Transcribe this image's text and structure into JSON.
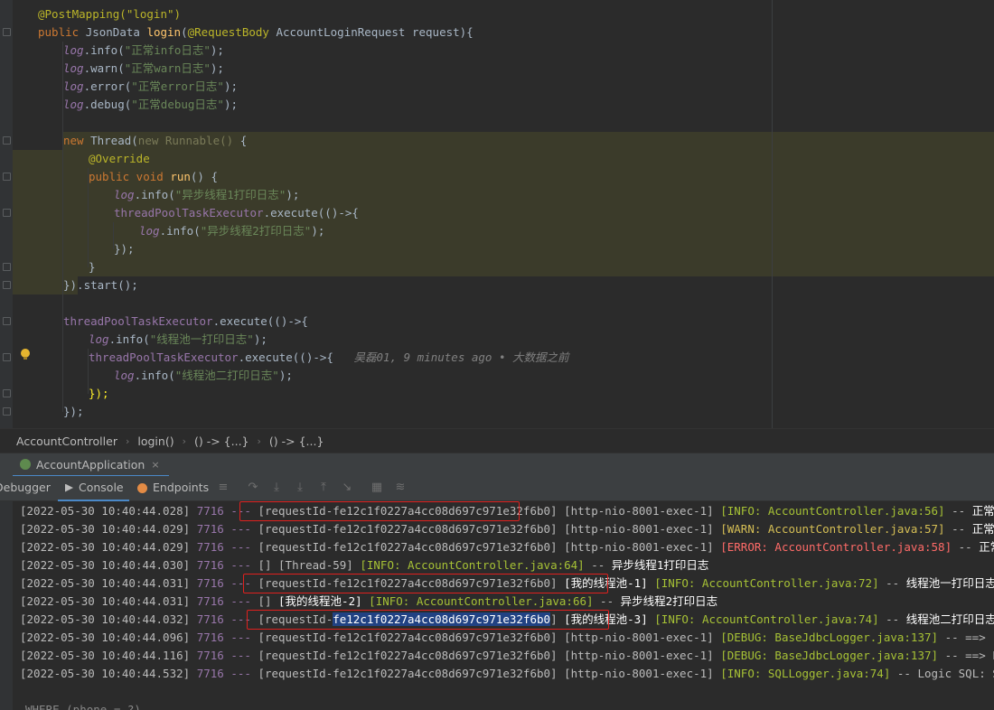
{
  "editor": {
    "annotation": "@PostMapping(\"login\")",
    "signature": {
      "modifier": "public",
      "ret": "JsonData",
      "name": "login",
      "param_ann": "@RequestBody",
      "param_type": "AccountLoginRequest request"
    },
    "log_lines": [
      {
        "method": "info",
        "text": "\"正常info日志\""
      },
      {
        "method": "warn",
        "text": "\"正常warn日志\""
      },
      {
        "method": "error",
        "text": "\"正常error日志\""
      },
      {
        "method": "debug",
        "text": "\"正常debug日志\""
      }
    ],
    "thread_block": {
      "new_kw": "new",
      "thread_cls": "Thread(",
      "runnable": "new Runnable() ",
      "override": "@Override",
      "run_sig_kw": "public void",
      "run_name": "run",
      "log1": "\"异步线程1打印日志\"",
      "executor": "threadPoolTaskExecutor",
      "execute": ".execute(()->{",
      "log2": "\"异步线程2打印日志\"",
      "close1": "});",
      "close2": "}",
      "start": ").start();"
    },
    "pool_block": {
      "log1": "\"线程池一打印日志\"",
      "log2": "\"线程池二打印日志\"",
      "blame": "吴磊01, 9 minutes ago • 大数据之前",
      "close_inner": "});",
      "close_outer": "});"
    },
    "log_ident": "log",
    "info_m": "info"
  },
  "breadcrumb": [
    "AccountController",
    "login()",
    "() -> {...}",
    "() -> {...}"
  ],
  "run_tab": {
    "label": "AccountApplication",
    "close": "×"
  },
  "toolbar": {
    "debugger": "Debugger",
    "console": "Console",
    "endpoints": "Endpoints"
  },
  "console": {
    "lines": [
      {
        "ts": "[2022-05-30 10:40:44.028]",
        "pid": "7716",
        "req": "[requestId-fe12c1f0227a4cc08d697c971e32f6b0]",
        "thread": "[http-nio-8001-exec-1]",
        "level": "[INFO: AccountController.java:56]",
        "lvl": "info",
        "msg": "正常info日志"
      },
      {
        "ts": "[2022-05-30 10:40:44.029]",
        "pid": "7716",
        "req": "[requestId-fe12c1f0227a4cc08d697c971e32f6b0]",
        "thread": "[http-nio-8001-exec-1]",
        "level": "[WARN: AccountController.java:57]",
        "lvl": "warn",
        "msg": "正常warn日志"
      },
      {
        "ts": "[2022-05-30 10:40:44.029]",
        "pid": "7716",
        "req": "[requestId-fe12c1f0227a4cc08d697c971e32f6b0]",
        "thread": "[http-nio-8001-exec-1]",
        "level": "[ERROR: AccountController.java:58]",
        "lvl": "err",
        "msg": "正常error日志"
      },
      {
        "ts": "[2022-05-30 10:40:44.030]",
        "pid": "7716",
        "req": "[]",
        "thread": "[Thread-59]",
        "level": "[INFO: AccountController.java:64]",
        "lvl": "info",
        "msg": "异步线程1打印日志"
      },
      {
        "ts": "[2022-05-30 10:40:44.031]",
        "pid": "7716",
        "req": "[requestId-fe12c1f0227a4cc08d697c971e32f6b0]",
        "thread": "[我的线程池-1]",
        "level": "[INFO: AccountController.java:72]",
        "lvl": "info",
        "msg": "线程池一打印日志"
      },
      {
        "ts": "[2022-05-30 10:40:44.031]",
        "pid": "7716",
        "req": "[]",
        "thread": "[我的线程池-2]",
        "level": "[INFO: AccountController.java:66]",
        "lvl": "info",
        "msg": "异步线程2打印日志"
      },
      {
        "ts": "[2022-05-30 10:40:44.032]",
        "pid": "7716",
        "req_pre": "[requestId-",
        "req_sel": "fe12c1f0227a4cc08d697c971e32f6b0",
        "req_post": "]",
        "thread": "[我的线程池-3]",
        "level": "[INFO: AccountController.java:74]",
        "lvl": "info",
        "msg": "线程池二打印日志"
      },
      {
        "ts": "[2022-05-30 10:40:44.096]",
        "pid": "7716",
        "req": "[requestId-fe12c1f0227a4cc08d697c971e32f6b0]",
        "thread": "[http-nio-8001-exec-1]",
        "level": "[DEBUG: BaseJdbcLogger.java:137]",
        "lvl": "dbg",
        "msg": "==>  Preparing:"
      },
      {
        "ts": "[2022-05-30 10:40:44.116]",
        "pid": "7716",
        "req": "[requestId-fe12c1f0227a4cc08d697c971e32f6b0]",
        "thread": "[http-nio-8001-exec-1]",
        "level": "[DEBUG: BaseJdbcLogger.java:137]",
        "lvl": "dbg",
        "msg": "==> Parameters:"
      },
      {
        "ts": "[2022-05-30 10:40:44.532]",
        "pid": "7716",
        "req": "[requestId-fe12c1f0227a4cc08d697c971e32f6b0]",
        "thread": "[http-nio-8001-exec-1]",
        "level": "[INFO: SQLLogger.java:74]",
        "lvl": "info",
        "msg": "Logic SQL: SELECT  id,"
      }
    ],
    "trailing": "WHERE (phone = ?)",
    "sep": "---"
  }
}
